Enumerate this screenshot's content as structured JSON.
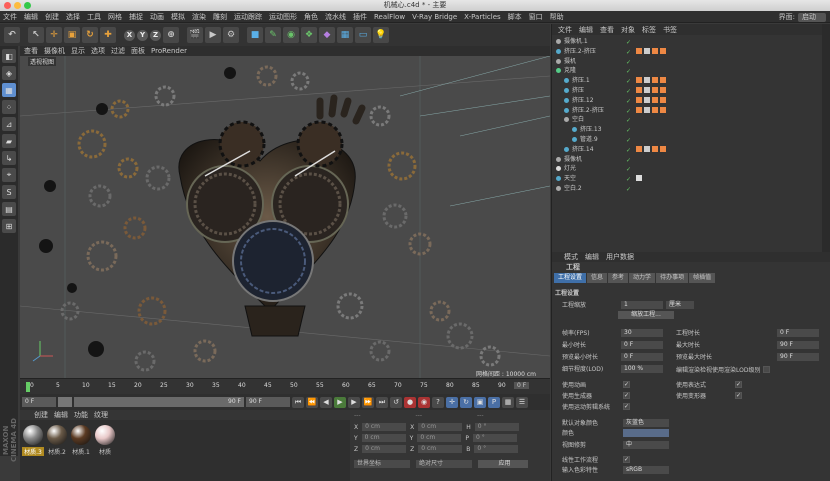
{
  "window": {
    "title": "机械心.c4d * - 主要"
  },
  "menu": [
    "文件",
    "编辑",
    "创建",
    "选择",
    "工具",
    "网格",
    "捕捉",
    "动画",
    "模拟",
    "渲染",
    "雕刻",
    "运动跟踪",
    "运动图形",
    "角色",
    "流水线",
    "插件",
    "RealFlow",
    "V-Ray Bridge",
    "X-Particles",
    "脚本",
    "窗口",
    "帮助"
  ],
  "interface": {
    "label": "界面:",
    "value": "启动"
  },
  "viewport": {
    "menu": [
      "查看",
      "摄像机",
      "显示",
      "选项",
      "过滤",
      "面板",
      "ProRender"
    ],
    "label": "透视视图",
    "footer": "网格间距 : 10000 cm"
  },
  "timeline": {
    "ticks": [
      "0",
      "5",
      "10",
      "15",
      "20",
      "25",
      "30",
      "35",
      "40",
      "45",
      "50",
      "55",
      "60",
      "65",
      "70",
      "75",
      "80",
      "85",
      "90"
    ],
    "end_label": "0 F"
  },
  "playback": {
    "start": "0 F",
    "current": "0 F",
    "end": "90 F",
    "max": "90 F"
  },
  "materials": {
    "menu": [
      "创建",
      "编辑",
      "功能",
      "纹理"
    ],
    "items": [
      {
        "name": "材质.3",
        "color": "#8a8a8a"
      },
      {
        "name": "材质.2",
        "color": "#6a5a48"
      },
      {
        "name": "材质.1",
        "color": "#5b3a22"
      },
      {
        "name": "材质",
        "color": "#e8c8c8"
      }
    ]
  },
  "coords": {
    "header": [
      "---",
      "---",
      "---"
    ],
    "rows": [
      {
        "a": "X",
        "av": "0 cm",
        "b": "X",
        "bv": "0 cm",
        "c": "H",
        "cv": "0 °"
      },
      {
        "a": "Y",
        "av": "0 cm",
        "b": "Y",
        "bv": "0 cm",
        "c": "P",
        "cv": "0 °"
      },
      {
        "a": "Z",
        "av": "0 cm",
        "b": "Z",
        "bv": "0 cm",
        "c": "B",
        "cv": "0 °"
      }
    ],
    "mode1": "世界坐标",
    "mode2": "绝对尺寸",
    "apply": "应用"
  },
  "objects": {
    "menu": [
      "文件",
      "编辑",
      "查看",
      "对象",
      "标签",
      "书签"
    ],
    "rows": [
      {
        "name": "摄像机.1",
        "indent": 0,
        "color": "#aaa"
      },
      {
        "name": "挤压.2-挤压",
        "indent": 0,
        "color": "#5ac"
      },
      {
        "name": "摄机",
        "indent": 0,
        "color": "#aaa"
      },
      {
        "name": "克隆",
        "indent": 0,
        "color": "#5c8"
      },
      {
        "name": "挤压.1",
        "indent": 1,
        "color": "#5ac"
      },
      {
        "name": "挤压",
        "indent": 1,
        "color": "#5ac"
      },
      {
        "name": "挤压.12",
        "indent": 1,
        "color": "#5ac"
      },
      {
        "name": "挤压.2-挤压",
        "indent": 1,
        "color": "#5ac"
      },
      {
        "name": "空白",
        "indent": 1,
        "color": "#aaa"
      },
      {
        "name": "挤压.13",
        "indent": 2,
        "color": "#5ac"
      },
      {
        "name": "管道.9",
        "indent": 2,
        "color": "#5ac"
      },
      {
        "name": "挤压.14",
        "indent": 1,
        "color": "#5ac"
      },
      {
        "name": "摄像机",
        "indent": 0,
        "color": "#aaa"
      },
      {
        "name": "灯光",
        "indent": 0,
        "color": "#ddd"
      },
      {
        "name": "天空",
        "indent": 0,
        "color": "#5ac"
      },
      {
        "name": "空白.2",
        "indent": 0,
        "color": "#aaa"
      }
    ]
  },
  "attributes": {
    "menu": [
      "模式",
      "编辑",
      "用户数据"
    ],
    "title": "工程",
    "tabs": [
      "工程设置",
      "信息",
      "参考",
      "动力学",
      "待办事项",
      "帧插值"
    ],
    "section": "工程设置",
    "scale_label": "工程缩放",
    "scale_value": "1",
    "scale_unit": "厘米",
    "scale_button": "缩放工程...",
    "left_fields": [
      {
        "label": "帧率(FPS)",
        "value": "30"
      },
      {
        "label": "最小时长",
        "value": "0 F"
      },
      {
        "label": "预览最小时长",
        "value": "0 F"
      },
      {
        "label": "细节程度(LOD)",
        "value": "100 %"
      }
    ],
    "right_fields": [
      {
        "label": "工程时长",
        "value": "0 F"
      },
      {
        "label": "最大时长",
        "value": "90 F"
      },
      {
        "label": "预览最大时长",
        "value": "90 F"
      }
    ],
    "lod_check": "编辑渲染检视使用渲染LOD级别",
    "checks_left": [
      "使用动画",
      "使用生成器",
      "使用运动剪辑系统"
    ],
    "checks_right": [
      "使用表达式",
      "使用变形器"
    ],
    "default_color_label": "默认对象颜色",
    "default_color_value": "灰蓝色",
    "color_label": "颜色",
    "view_clip_label": "视图修剪",
    "view_clip_value": "中",
    "linear_label": "线性工作流程",
    "input_color_label": "输入色彩特性",
    "input_color_value": "sRGB"
  }
}
